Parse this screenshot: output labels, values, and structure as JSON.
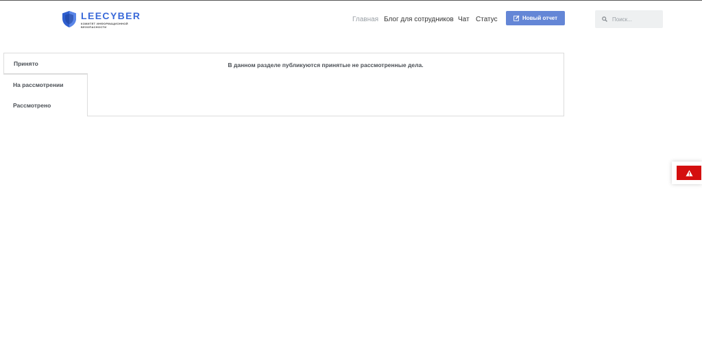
{
  "brand": {
    "name": "LEECYBER",
    "tagline": "КОМИТЕТ ИНФОРМАЦИОННОЙ БЕЗОПАСНОСТИ",
    "accent_color": "#3a6ad9"
  },
  "nav": {
    "items": [
      {
        "label": "Главная",
        "active": true
      },
      {
        "label": "Блог для сотрудников",
        "active": false
      },
      {
        "label": "Чат",
        "active": false
      },
      {
        "label": "Статус",
        "active": false
      }
    ],
    "new_report_label": "Новый отчет",
    "new_report_icon": "edit-icon",
    "button_color": "#6486d6"
  },
  "search": {
    "placeholder": "Поиск...",
    "icon": "search-icon"
  },
  "tabs": {
    "items": [
      {
        "label": "Принято",
        "active": true
      },
      {
        "label": "На рассмотрении",
        "active": false
      },
      {
        "label": "Рассмотрено",
        "active": false
      }
    ],
    "content": "В данном разделе публикуются принятые не рассмотренные дела."
  },
  "alert": {
    "icon": "warning-icon",
    "color": "#d40f0f"
  }
}
